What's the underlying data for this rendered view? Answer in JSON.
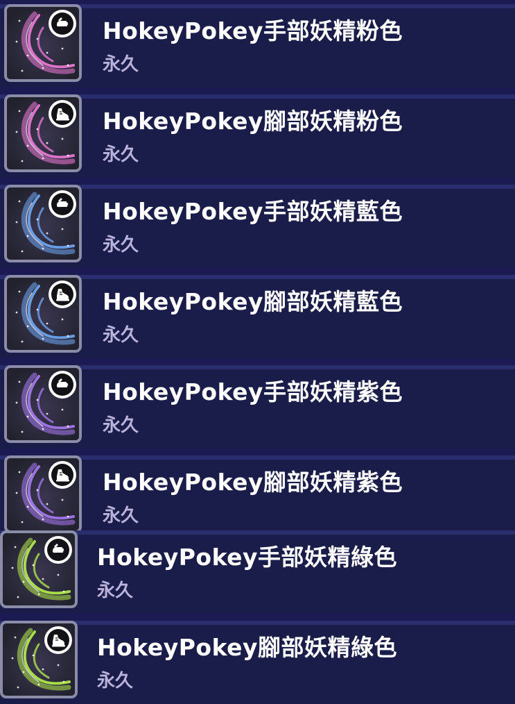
{
  "items": [
    {
      "title": "HokeyPokey手部妖精粉色",
      "duration": "永久",
      "slot_icon": "hand-icon",
      "effect_color": "#f07ad8"
    },
    {
      "title": "HokeyPokey腳部妖精粉色",
      "duration": "永久",
      "slot_icon": "sneaker-icon",
      "effect_color": "#f07ad8"
    },
    {
      "title": "HokeyPokey手部妖精藍色",
      "duration": "永久",
      "slot_icon": "hand-icon",
      "effect_color": "#6fa8f5"
    },
    {
      "title": "HokeyPokey腳部妖精藍色",
      "duration": "永久",
      "slot_icon": "sneaker-icon",
      "effect_color": "#6fa8f5"
    },
    {
      "title": "HokeyPokey手部妖精紫色",
      "duration": "永久",
      "slot_icon": "hand-icon",
      "effect_color": "#a97af5"
    },
    {
      "title": "HokeyPokey腳部妖精紫色",
      "duration": "永久",
      "slot_icon": "sneaker-icon",
      "effect_color": "#a97af5"
    },
    {
      "title": "HokeyPokey手部妖精綠色",
      "duration": "永久",
      "slot_icon": "hand-icon",
      "effect_color": "#b6ef4a"
    },
    {
      "title": "HokeyPokey腳部妖精綠色",
      "duration": "永久",
      "slot_icon": "sneaker-icon",
      "effect_color": "#b6ef4a"
    }
  ]
}
